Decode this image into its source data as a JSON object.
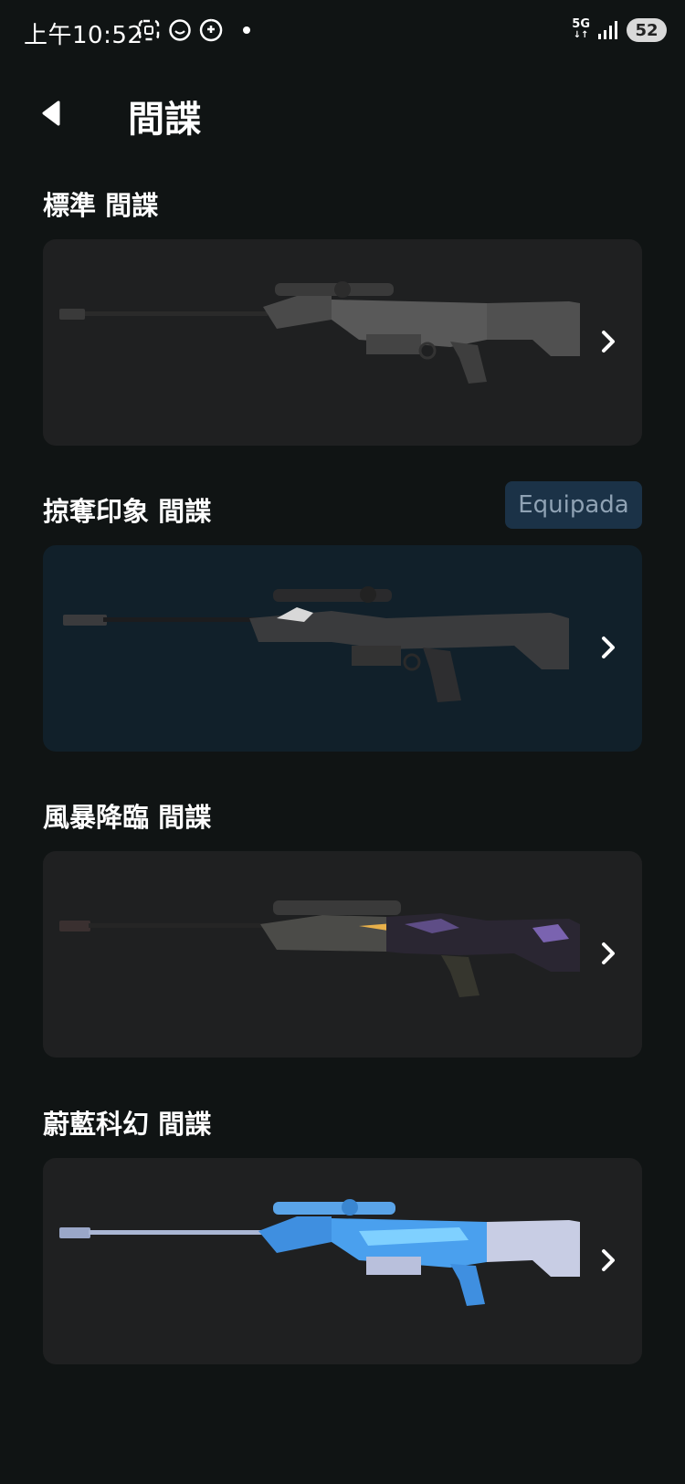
{
  "status_bar": {
    "time": "上午10:52",
    "network": "5G",
    "battery": "52"
  },
  "header": {
    "title": "間諜"
  },
  "skins": [
    {
      "name": "標準 間諜",
      "equipped": false,
      "accent": "#6c6c6c"
    },
    {
      "name": "掠奪印象 間諜",
      "equipped": true,
      "badge": "Equipada",
      "accent": "#3c3d40"
    },
    {
      "name": "風暴降臨 間諜",
      "equipped": false,
      "accent": "#5a4a78"
    },
    {
      "name": "蔚藍科幻 間諜",
      "equipped": false,
      "accent": "#3a8fe0"
    }
  ],
  "colors": {
    "background": "#101414",
    "card": "#1f2021",
    "card_equipped": "#11202a",
    "badge_bg": "#1b3247",
    "badge_text": "#8fa2b4"
  },
  "icons": {
    "back": "back-arrow-icon",
    "chevron": "chevron-right-icon"
  }
}
